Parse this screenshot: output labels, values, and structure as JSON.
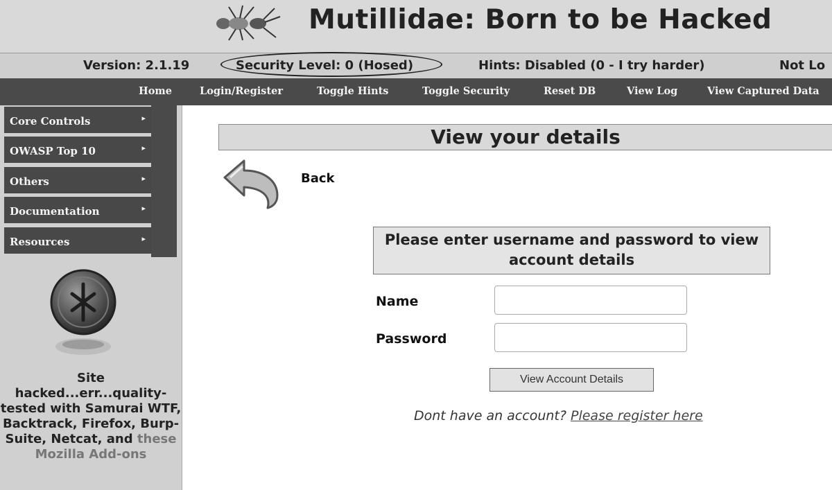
{
  "header": {
    "title": "Mutillidae: Born to be Hacked",
    "logo_icon": "ant-logo-icon"
  },
  "status": {
    "version": "Version: 2.1.19",
    "security_level": "Security Level: 0 (Hosed)",
    "hints": "Hints: Disabled (0 - I try harder)",
    "login_state": "Not Lo"
  },
  "menubar": {
    "items": [
      "Home",
      "Login/Register",
      "Toggle Hints",
      "Toggle Security",
      "Reset DB",
      "View Log",
      "View Captured Data"
    ]
  },
  "sidebar": {
    "items": [
      "Core Controls",
      "OWASP Top 10",
      "Others",
      "Documentation",
      "Resources"
    ],
    "arrow": "▸",
    "logo_icon": "owasp-logo-icon",
    "blurb_line1": "Site hacked...err...quality-tested with Samurai WTF, Backtrack, Firefox, Burp-Suite, Netcat, and",
    "blurb_link": "these Mozilla Add-ons"
  },
  "main": {
    "heading": "View your details",
    "back_label": "Back",
    "back_icon": "back-arrow-icon",
    "form_title": "Please enter username and password to view account details",
    "name_label": "Name",
    "password_label": "Password",
    "name_value": "",
    "password_value": "",
    "submit_label": "View Account Details",
    "register_prompt": "Dont have an account?",
    "register_link": "Please register here"
  }
}
